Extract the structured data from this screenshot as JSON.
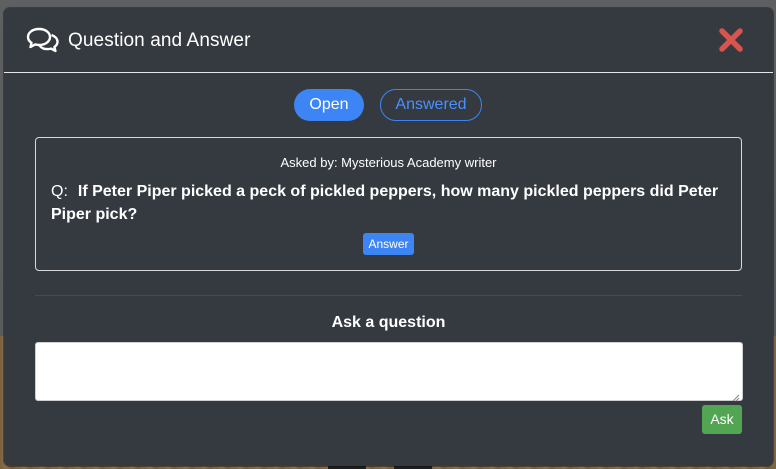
{
  "modal": {
    "title": "Question and Answer",
    "header_icon": "comments-icon",
    "close_icon": "close-x-icon",
    "close_color": "#d9534f"
  },
  "tabs": [
    {
      "label": "Open",
      "active": true
    },
    {
      "label": "Answered",
      "active": false
    }
  ],
  "question": {
    "asked_by": "Asked by: Mysterious Academy writer",
    "prefix": "Q:",
    "text": "If Peter Piper picked a peck of pickled peppers, how many pickled peppers did Peter Piper pick?",
    "answer_label": "Answer"
  },
  "ask": {
    "heading": "Ask a question",
    "value": "",
    "submit_label": "Ask"
  },
  "colors": {
    "modal_bg": "#343a40",
    "primary": "#3d85f5",
    "success": "#52a552"
  }
}
